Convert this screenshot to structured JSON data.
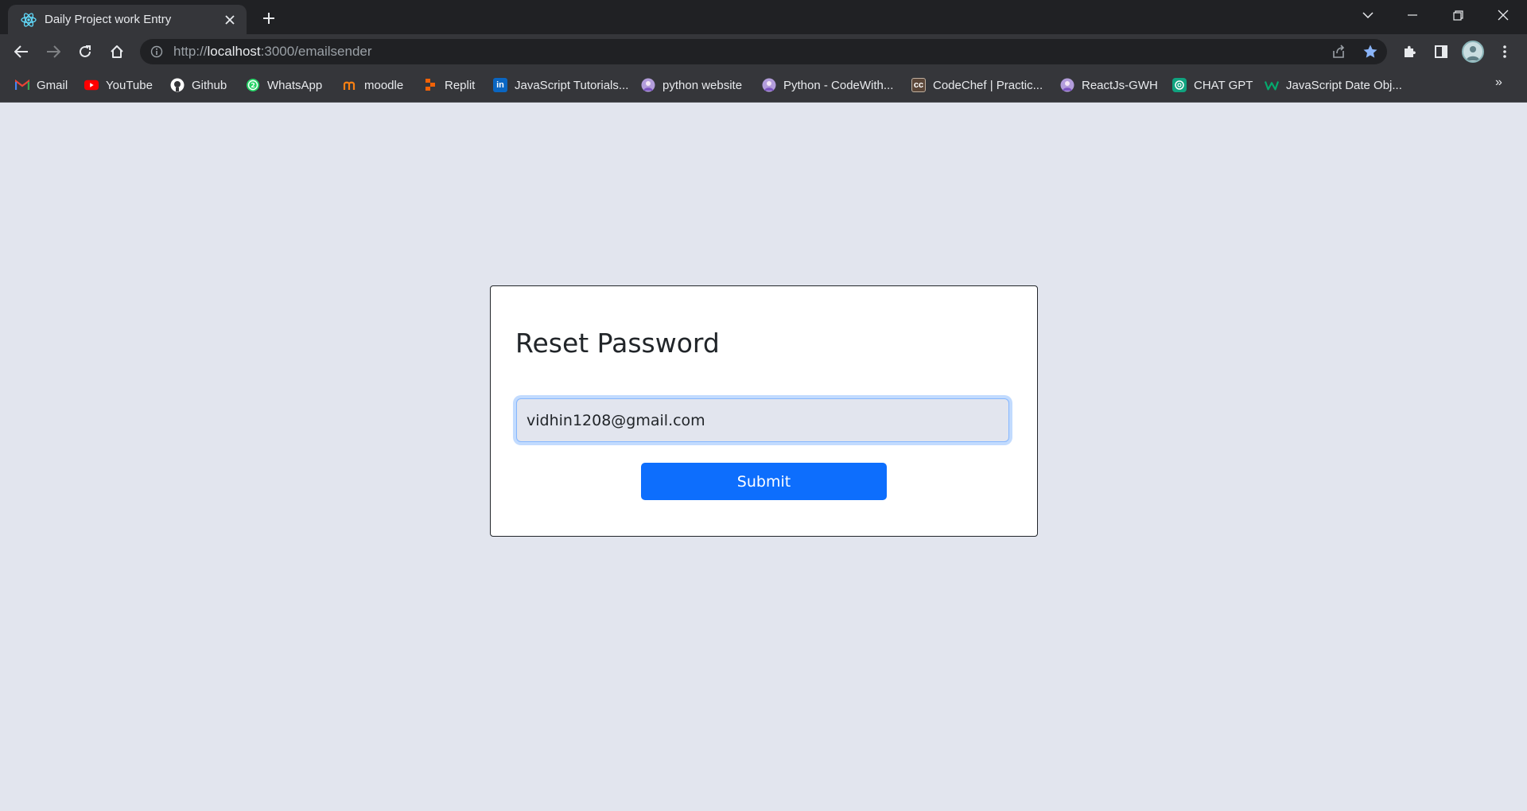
{
  "browser": {
    "tab_title": "Daily Project work Entry",
    "url_scheme": "http://",
    "url_host": "localhost",
    "url_path": ":3000/emailsender"
  },
  "bookmarks": [
    {
      "label": "Gmail",
      "icon": "gmail-icon",
      "color": "#ea4335"
    },
    {
      "label": "YouTube",
      "icon": "youtube-icon",
      "color": "#ff0000"
    },
    {
      "label": "Github",
      "icon": "github-icon",
      "color": "#ffffff"
    },
    {
      "label": "WhatsApp",
      "icon": "whatsapp-icon",
      "color": "#25d366"
    },
    {
      "label": "moodle",
      "icon": "moodle-icon",
      "color": "#f98012"
    },
    {
      "label": "Replit",
      "icon": "replit-icon",
      "color": "#f26207"
    },
    {
      "label": "JavaScript Tutorials...",
      "icon": "linkedin-icon",
      "color": "#0a66c2"
    },
    {
      "label": "python website",
      "icon": "codewithharry-icon",
      "color": "#b39ddb"
    },
    {
      "label": "Python - CodeWith...",
      "icon": "codewithharry-icon",
      "color": "#b39ddb"
    },
    {
      "label": "CodeChef | Practic...",
      "icon": "codechef-icon",
      "color": "#5b4638"
    },
    {
      "label": "ReactJs-GWH",
      "icon": "codewithharry-icon",
      "color": "#b39ddb"
    },
    {
      "label": "CHAT GPT",
      "icon": "chatgpt-icon",
      "color": "#10a37f"
    },
    {
      "label": "JavaScript Date Obj...",
      "icon": "w3schools-icon",
      "color": "#04aa6d"
    }
  ],
  "bookmarks_more": "»",
  "form": {
    "title": "Reset Password",
    "email_value": "vidhin1208@gmail.com",
    "submit_label": "Submit"
  },
  "colors": {
    "page_background": "#e2e5ee",
    "primary": "#0d6efd"
  }
}
